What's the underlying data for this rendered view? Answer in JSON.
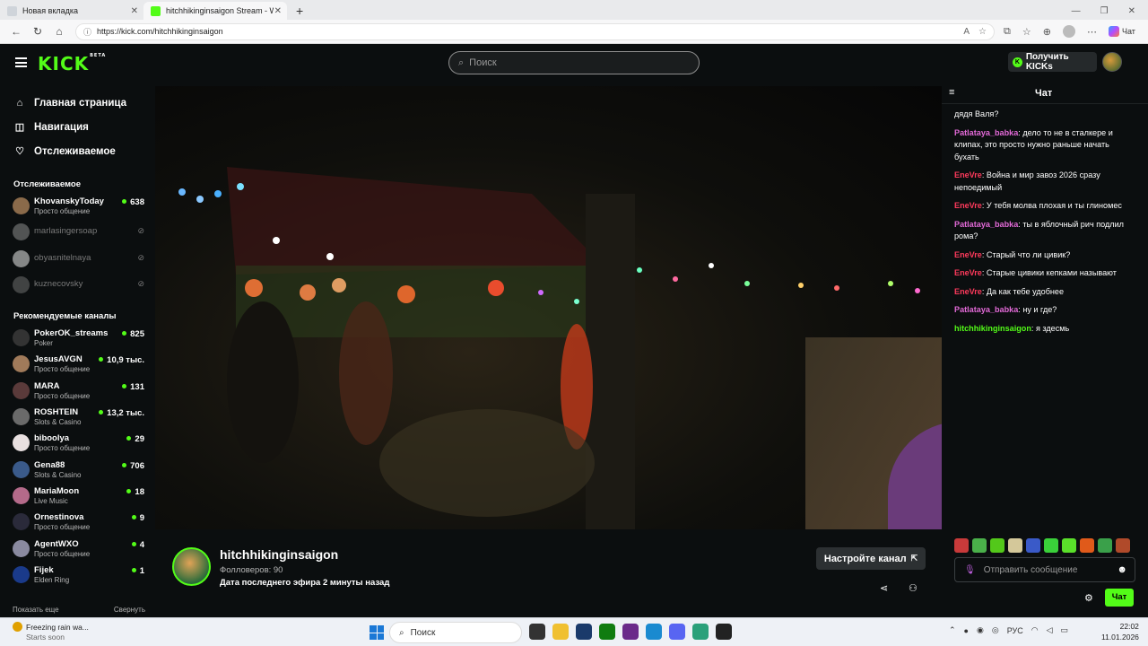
{
  "browser": {
    "tabs": [
      {
        "label": "Новая вкладка",
        "favicon": "new-tab-icon"
      },
      {
        "label": "hitchhikinginsaigon Stream - Wat",
        "favicon": "kick-icon"
      }
    ],
    "url": "https://kick.com/hitchhikinginsaigon",
    "chat_button_label": "Чат"
  },
  "kick": {
    "logo": "KICK",
    "logo_badge": "BETA",
    "search_placeholder": "Поиск",
    "get_kicks_label": "Получить KICKs",
    "accent": "#53fc18"
  },
  "sidebar": {
    "nav": [
      {
        "label": "Главная страница",
        "icon": "home-icon"
      },
      {
        "label": "Навигация",
        "icon": "compass-icon"
      },
      {
        "label": "Отслеживаемое",
        "icon": "heart-icon"
      }
    ],
    "followed_title": "Отслеживаемое",
    "followed": [
      {
        "name": "KhovanskyToday",
        "category": "Просто общение",
        "viewers": "638",
        "live": true
      },
      {
        "name": "marlasingersoap",
        "live": false
      },
      {
        "name": "obyasnitelnaya",
        "live": false
      },
      {
        "name": "kuznecovsky",
        "live": false
      }
    ],
    "recommended_title": "Рекомендуемые каналы",
    "recommended": [
      {
        "name": "PokerOK_streams",
        "category": "Poker",
        "viewers": "825"
      },
      {
        "name": "JesusAVGN",
        "category": "Просто общение",
        "viewers": "10,9 тыс."
      },
      {
        "name": "MARA",
        "category": "Просто общение",
        "viewers": "131"
      },
      {
        "name": "ROSHTEIN",
        "category": "Slots & Casino",
        "viewers": "13,2 тыс."
      },
      {
        "name": "biboolya",
        "category": "Просто общение",
        "viewers": "29"
      },
      {
        "name": "Gena88",
        "category": "Slots & Casino",
        "viewers": "706"
      },
      {
        "name": "MariaMoon",
        "category": "Live Music",
        "viewers": "18"
      },
      {
        "name": "Ornestinova",
        "category": "Просто общение",
        "viewers": "9"
      },
      {
        "name": "AgentWXO",
        "category": "Просто общение",
        "viewers": "4"
      },
      {
        "name": "Fijek",
        "category": "Elden Ring",
        "viewers": "1"
      }
    ],
    "show_more": "Показать еще",
    "collapse": "Свернуть"
  },
  "channel": {
    "name": "hitchhikinginsaigon",
    "followers": "Фолловеров: 90",
    "last_live": "Дата последнего эфира 2 минуты назад",
    "setup_button": "Настройте канал"
  },
  "chat": {
    "title": "Чат",
    "messages": [
      {
        "user": "",
        "text": "дядя Валя?",
        "color": "#ffffff"
      },
      {
        "user": "Patlataya_babka",
        "text": ": дело то не в сталкере и клипах, это просто нужно раньше начать бухать",
        "color": "#e36ad8"
      },
      {
        "user": "EneVre",
        "text": ": Война и мир завоз 2026 сразу непоедимый",
        "color": "#ff3a5c"
      },
      {
        "user": "EneVre",
        "text": ": У тебя молва плохая и ты глиномес",
        "color": "#ff3a5c"
      },
      {
        "user": "Patlataya_babka",
        "text": ": ты в яблочный рич подлил рома?",
        "color": "#e36ad8"
      },
      {
        "user": "EneVre",
        "text": ": Старый что ли цивик?",
        "color": "#ff3a5c"
      },
      {
        "user": "EneVre",
        "text": ": Старые цивики кепками называют",
        "color": "#ff3a5c"
      },
      {
        "user": "EneVre",
        "text": ": Да как тебе удобнее",
        "color": "#ff3a5c"
      },
      {
        "user": "Patlataya_babka",
        "text": ": ну и где?",
        "color": "#e36ad8"
      },
      {
        "user": "hitchhikinginsaigon",
        "text": ": я здесмь",
        "color": "#53fc18"
      }
    ],
    "input_placeholder": "Отправить сообщение",
    "send_label": "Чат"
  },
  "taskbar": {
    "notification_title": "Freezing rain wa...",
    "notification_sub": "Starts soon",
    "search_label": "Поиск",
    "language": "РУС",
    "time": "22:02",
    "date": "11.01.2026"
  }
}
